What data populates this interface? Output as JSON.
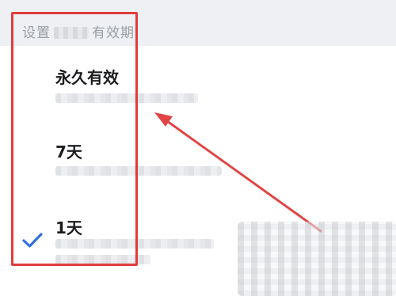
{
  "dialog": {
    "title_prefix": "设置",
    "title_suffix": "有效期"
  },
  "options": [
    {
      "label": "永久有效",
      "selected": false
    },
    {
      "label": "7天",
      "selected": false
    },
    {
      "label": "1天",
      "selected": true
    }
  ],
  "colors": {
    "highlight": "#e03c3c",
    "check": "#2f6fe0",
    "title_text": "#9a9ea5"
  },
  "icons": {
    "selected_marker": "check-icon"
  }
}
